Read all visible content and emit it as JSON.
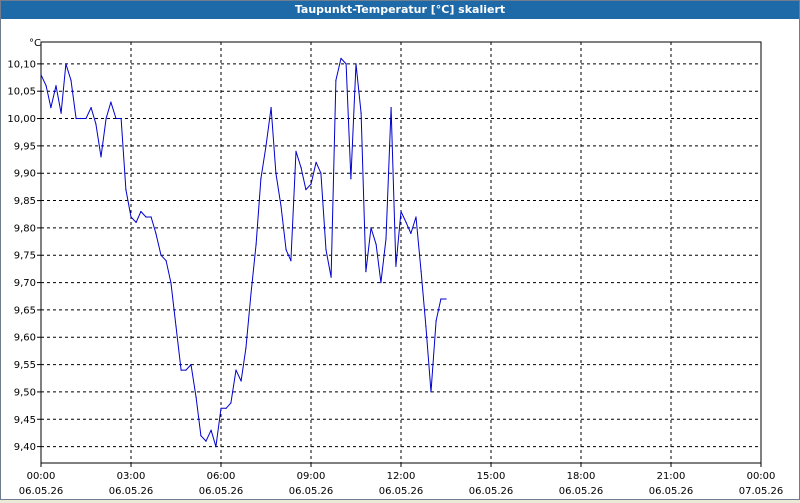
{
  "window": {
    "title": "Taupunkt-Temperatur [°C] skaliert"
  },
  "chart_data": {
    "type": "line",
    "title": "Taupunkt-Temperatur [°C] skaliert",
    "ylabel": "°C",
    "xlabel": "",
    "grid": true,
    "ylim": [
      9.37,
      10.14
    ],
    "xlim": [
      0,
      24
    ],
    "y_ticks": [
      "10,10",
      "10,05",
      "10,00",
      "9,95",
      "9,90",
      "9,85",
      "9,80",
      "9,75",
      "9,70",
      "9,65",
      "9,60",
      "9,55",
      "9,50",
      "9,45",
      "9,40"
    ],
    "y_tick_values": [
      10.1,
      10.05,
      10.0,
      9.95,
      9.9,
      9.85,
      9.8,
      9.75,
      9.7,
      9.65,
      9.6,
      9.55,
      9.5,
      9.45,
      9.4
    ],
    "x_ticks": [
      {
        "time": "00:00",
        "date": "06.05.26",
        "hour": 0
      },
      {
        "time": "03:00",
        "date": "06.05.26",
        "hour": 3
      },
      {
        "time": "06:00",
        "date": "06.05.26",
        "hour": 6
      },
      {
        "time": "09:00",
        "date": "06.05.26",
        "hour": 9
      },
      {
        "time": "12:00",
        "date": "06.05.26",
        "hour": 12
      },
      {
        "time": "15:00",
        "date": "06.05.26",
        "hour": 15
      },
      {
        "time": "18:00",
        "date": "06.05.26",
        "hour": 18
      },
      {
        "time": "21:00",
        "date": "06.05.26",
        "hour": 21
      },
      {
        "time": "00:00",
        "date": "07.05.26",
        "hour": 24
      }
    ],
    "line_color": "#0000cc",
    "series": [
      {
        "x": [
          0.0,
          0.17,
          0.33,
          0.5,
          0.67,
          0.83,
          1.0,
          1.17,
          1.33,
          1.5,
          1.67,
          1.83,
          2.0,
          2.17,
          2.33,
          2.5,
          2.67,
          2.83,
          3.0,
          3.17,
          3.33,
          3.5,
          3.67,
          3.83,
          4.0,
          4.17,
          4.33,
          4.5,
          4.67,
          4.83,
          5.0,
          5.17,
          5.33,
          5.5,
          5.67,
          5.83,
          6.0,
          6.17,
          6.33,
          6.5,
          6.67,
          6.83,
          7.0,
          7.17,
          7.33,
          7.5,
          7.67,
          7.83,
          8.0,
          8.17,
          8.33,
          8.5,
          8.67,
          8.83,
          9.0,
          9.17,
          9.33,
          9.5,
          9.67,
          9.83,
          10.0,
          10.17,
          10.33,
          10.5,
          10.67,
          10.83,
          11.0,
          11.17,
          11.33,
          11.5,
          11.67,
          11.83,
          12.0,
          12.17,
          12.33,
          12.5,
          12.67,
          12.83,
          13.0,
          13.17,
          13.33,
          13.5
        ],
        "y": [
          10.08,
          10.06,
          10.02,
          10.06,
          10.01,
          10.1,
          10.07,
          10.0,
          10.0,
          10.0,
          10.02,
          9.99,
          9.93,
          10.0,
          10.03,
          10.0,
          10.0,
          9.87,
          9.82,
          9.81,
          9.83,
          9.82,
          9.82,
          9.79,
          9.75,
          9.74,
          9.7,
          9.62,
          9.54,
          9.54,
          9.55,
          9.49,
          9.42,
          9.41,
          9.43,
          9.4,
          9.47,
          9.47,
          9.48,
          9.54,
          9.52,
          9.58,
          9.68,
          9.77,
          9.89,
          9.95,
          10.02,
          9.9,
          9.84,
          9.76,
          9.74,
          9.94,
          9.91,
          9.87,
          9.88,
          9.92,
          9.9,
          9.76,
          9.71,
          10.07,
          10.11,
          10.1,
          9.89,
          10.1,
          10.01,
          9.72,
          9.8,
          9.77,
          9.7,
          9.78,
          10.02,
          9.73,
          9.83,
          9.81,
          9.79,
          9.82,
          9.72,
          9.62,
          9.5,
          9.63,
          9.67,
          9.67
        ]
      }
    ]
  }
}
